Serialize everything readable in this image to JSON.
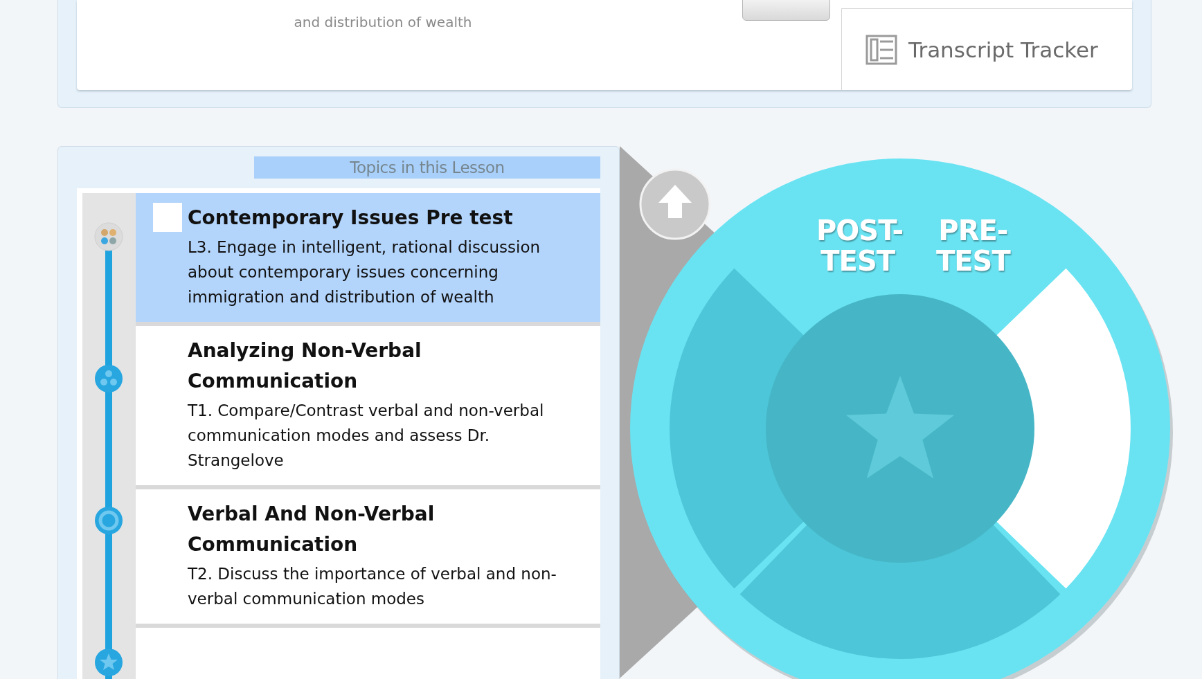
{
  "course_card": {
    "description_tail": "and distribution of wealth",
    "transcript_tracker": {
      "label": "Transcript Tracker"
    }
  },
  "lesson": {
    "heading": "Topics in this Lesson",
    "timeline": [
      {
        "kind": "multicolor"
      },
      {
        "kind": "dots"
      },
      {
        "kind": "ring"
      },
      {
        "kind": "star"
      }
    ],
    "topics": [
      {
        "kind": "test",
        "checked": false,
        "selected": true,
        "title": "Contemporary Issues Pre test",
        "description": "L3. Engage in intelligent, rational discussion about contemporary issues concerning immigration and distribution of wealth"
      },
      {
        "kind": "topic",
        "selected": false,
        "title": "Analyzing Non-Verbal Communication",
        "description": "T1. Compare/Contrast verbal and non-verbal communication modes and assess Dr. Strangelove"
      },
      {
        "kind": "topic",
        "selected": false,
        "title": "Verbal And Non-Verbal Communication",
        "description": "T2. Discuss the importance of verbal and non-verbal communication modes"
      }
    ]
  },
  "progress_wheel": {
    "labels": [
      "POST-TEST",
      "PRE-TEST"
    ],
    "segments": [
      {
        "completed": false
      },
      {
        "completed": false
      },
      {
        "completed": true
      }
    ]
  }
}
